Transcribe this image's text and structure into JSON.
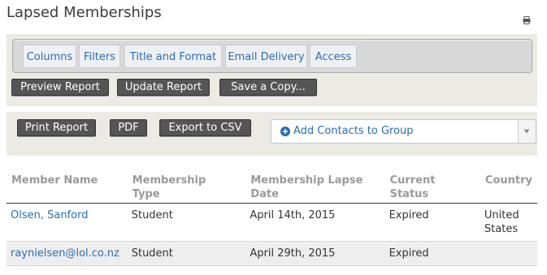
{
  "page": {
    "title": "Lapsed Memberships"
  },
  "tabs": [
    "Columns",
    "Filters",
    "Title and Format",
    "Email Delivery",
    "Access"
  ],
  "buttons": {
    "preview": "Preview Report",
    "update": "Update Report",
    "save_copy": "Save a Copy...",
    "print": "Print Report",
    "pdf": "PDF",
    "export_csv": "Export to CSV"
  },
  "group_select": {
    "label": "Add Contacts to Group"
  },
  "table": {
    "headers": [
      [
        "Member Name"
      ],
      [
        "Membership",
        "Type"
      ],
      [
        "Membership Lapse",
        "Date"
      ],
      [
        "Current",
        "Status"
      ],
      [
        "Country"
      ]
    ],
    "rows": [
      {
        "name": "Olsen, Sanford",
        "type": "Student",
        "date": "April 14th, 2015",
        "status": "Expired",
        "country": [
          "United",
          "States"
        ]
      },
      {
        "name": "raynielsen@lol.co.nz",
        "type": "Student",
        "date": "April 29th, 2015",
        "status": "Expired",
        "country": [
          "",
          ""
        ]
      }
    ]
  },
  "colors": {
    "link": "#2a6db4",
    "button": "#555555",
    "panel": "#ebebe4"
  },
  "icons": {
    "print": "printer-icon",
    "add": "plus-circle-icon",
    "dropdown": "chevron-down-icon"
  }
}
